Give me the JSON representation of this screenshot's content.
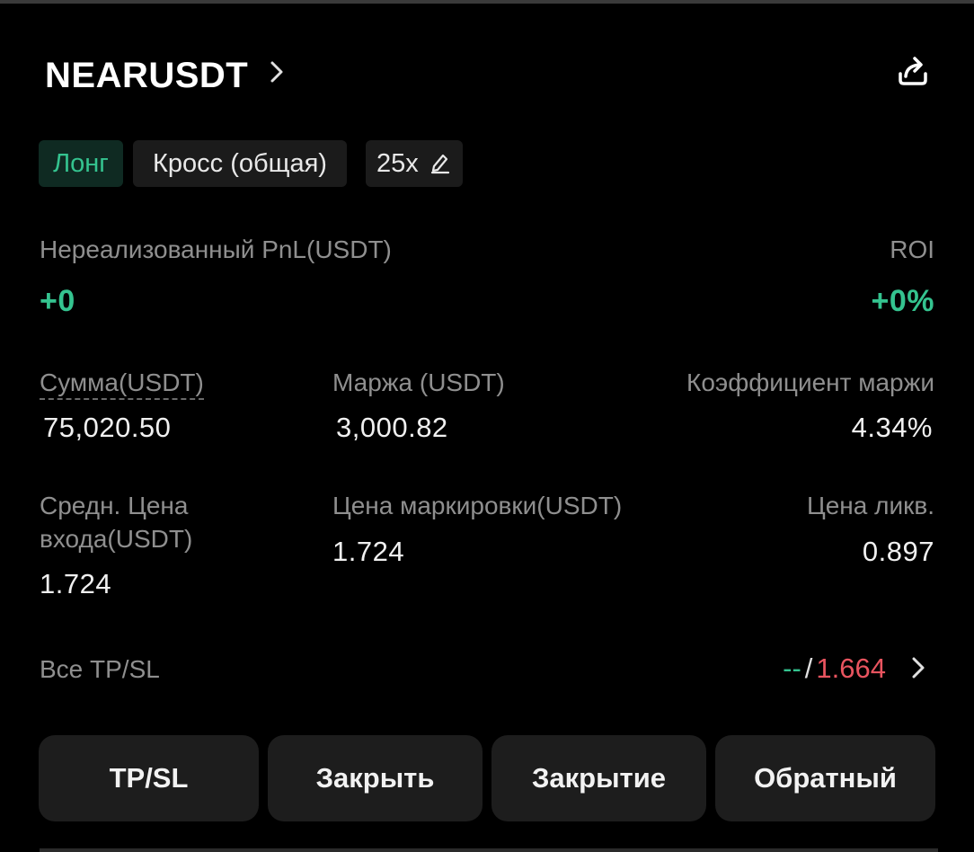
{
  "header": {
    "symbol": "NEARUSDT"
  },
  "tags": {
    "side": "Лонг",
    "margin_mode": "Кросс (общая)",
    "leverage": "25x"
  },
  "pnl": {
    "label": "Нереализованный PnL(USDT)",
    "value": "+0",
    "roi_label": "ROI",
    "roi_value": "+0%"
  },
  "stats_row1": {
    "amount_label": "Сумма(USDT)",
    "amount_value": "75,020.50",
    "margin_label": "Маржа (USDT)",
    "margin_value": "3,000.82",
    "ratio_label": "Коэффициент маржи",
    "ratio_value": "4.34%"
  },
  "stats_row2": {
    "entry_label_line1": "Средн. Цена",
    "entry_label_line2": "входа(USDT)",
    "entry_value": "1.724",
    "mark_label": "Цена маркировки(USDT)",
    "mark_value": "1.724",
    "liq_label": "Цена ликв.",
    "liq_value": "0.897"
  },
  "tpsl": {
    "label": "Все TP/SL",
    "tp_value": "--",
    "separator": "/",
    "sl_value": "1.664"
  },
  "actions": {
    "tpsl": "TP/SL",
    "close": "Закрыть",
    "close_all": "Закрытие",
    "reverse": "Обратный"
  },
  "colors": {
    "green": "#34c38f",
    "red": "#e8545f",
    "background": "#000000",
    "button": "#1d1d1d"
  },
  "icons": [
    "chevron-right-icon",
    "share-icon",
    "edit-pencil-icon"
  ]
}
